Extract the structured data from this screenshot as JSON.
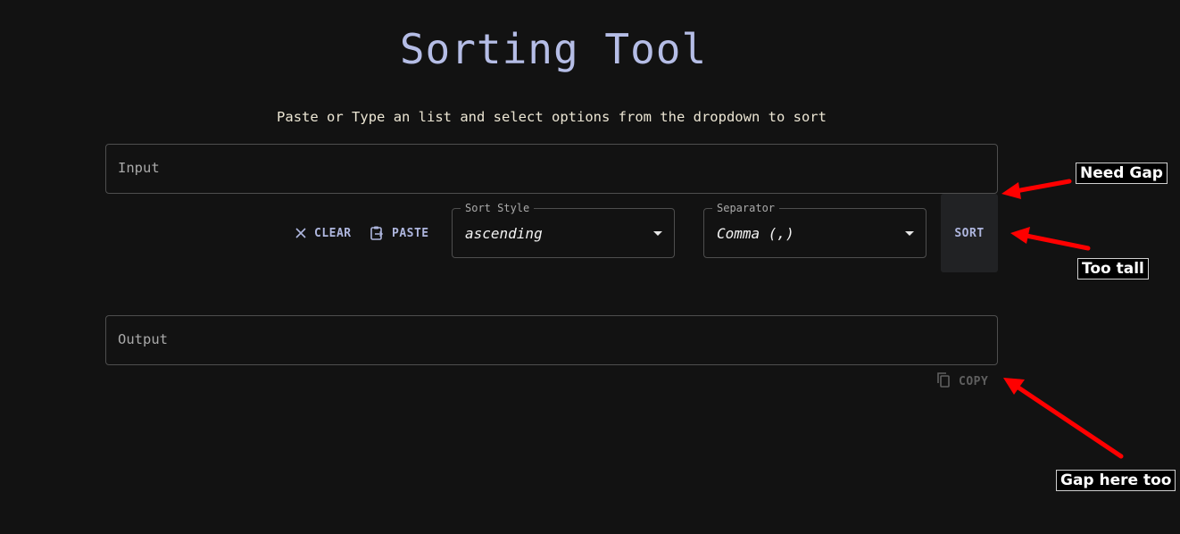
{
  "header": {
    "title": "Sorting Tool",
    "subtitle": "Paste or Type an list and select options from the dropdown to sort"
  },
  "input": {
    "placeholder": "Input",
    "value": ""
  },
  "toolbar": {
    "clear_label": "CLEAR",
    "paste_label": "PASTE",
    "sort_label": "SORT"
  },
  "sort_style": {
    "label": "Sort Style",
    "value": "ascending"
  },
  "separator": {
    "label": "Separator",
    "value": "Comma (,)"
  },
  "output": {
    "placeholder": "Output",
    "value": "",
    "copy_label": "COPY"
  },
  "annotations": {
    "need_gap": "Need Gap",
    "too_tall": "Too tall",
    "gap_here_too": "Gap here too",
    "arrow_color": "#ff0000"
  },
  "colors": {
    "background": "#121212",
    "accent": "#b5bde6",
    "border": "#4e4e4e",
    "sort_button_bg": "#212224"
  },
  "icons": {
    "clear": "close-icon",
    "paste": "clipboard-paste-icon",
    "copy": "copy-icon",
    "dropdown": "caret-down-icon"
  }
}
